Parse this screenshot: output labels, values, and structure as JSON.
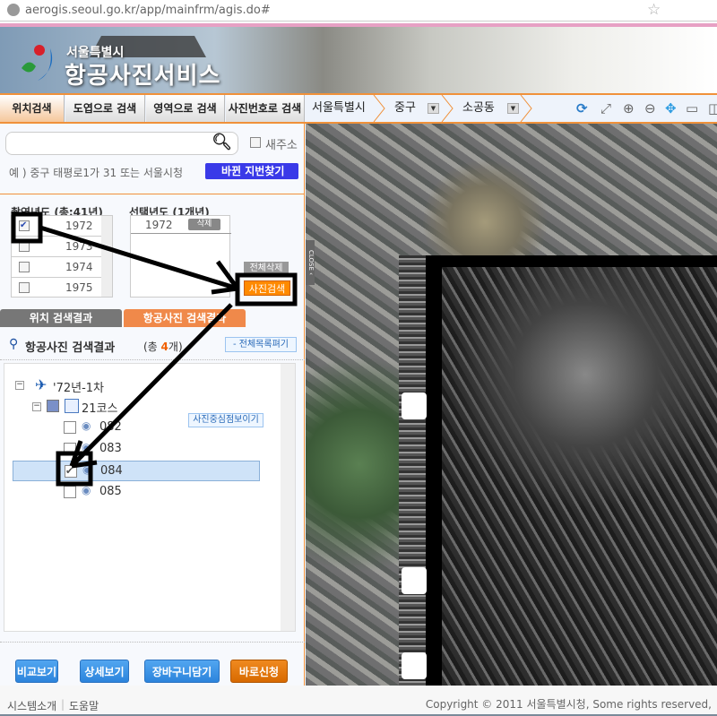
{
  "browser": {
    "url": "aerogis.seoul.go.kr/app/mainfrm/agis.do#"
  },
  "header": {
    "org": "서울특별시",
    "title": "항공사진서비스"
  },
  "nav": {
    "tabs": [
      "위치검색",
      "도엽으로 검색",
      "영역으로 검색",
      "사진번호로 검색"
    ],
    "crumbs": [
      "서울특별시",
      "중구",
      "소공동"
    ],
    "tools": [
      "refresh-icon",
      "fullscreen-icon",
      "zoom-in-icon",
      "zoom-out-icon",
      "pan-icon",
      "ruler-icon",
      "area-icon"
    ]
  },
  "search": {
    "value": "",
    "new_address_label": "새주소",
    "example": "예 ) 중구 태평로1가 31 또는 서울시청",
    "find_button": "바뀐 지번찾기"
  },
  "years": {
    "header": "촬영년도 (총:41년)",
    "items": [
      {
        "year": "1972",
        "checked": true
      },
      {
        "year": "1973",
        "checked": false
      },
      {
        "year": "1974",
        "checked": false
      },
      {
        "year": "1975",
        "checked": false
      }
    ]
  },
  "selected": {
    "header": "선택년도 (1개년)",
    "items": [
      {
        "year": "1972",
        "delete": "삭제"
      }
    ],
    "delete_all": "전체삭제",
    "search_button": "사진검색"
  },
  "result_tabs": [
    "위치 검색결과",
    "항공사진 검색결과"
  ],
  "results": {
    "title": "항공사진 검색결과",
    "count_prefix": "(총 ",
    "count": "4",
    "count_suffix": "개)",
    "expand_all": "- 전체목록펴기",
    "center_button": "사진중심점보이기",
    "tree": {
      "root": "'72년-1차",
      "course": "21코스",
      "photos": [
        {
          "id": "082",
          "checked": false
        },
        {
          "id": "083",
          "checked": false
        },
        {
          "id": "084",
          "checked": true
        },
        {
          "id": "085",
          "checked": false
        }
      ]
    }
  },
  "buttons": [
    "비교보기",
    "상세보기",
    "장바구니담기",
    "바로신청"
  ],
  "map": {
    "close_label": "CLOSE ‹"
  },
  "footer": {
    "links": [
      "시스템소개",
      "도움말"
    ],
    "copyright": "Copyright © 2011 서울특별시청, Some rights reserved,"
  },
  "colors": {
    "accent": "#f0913a",
    "blue_button": "#2c84dc",
    "orange_button": "#e07010"
  }
}
